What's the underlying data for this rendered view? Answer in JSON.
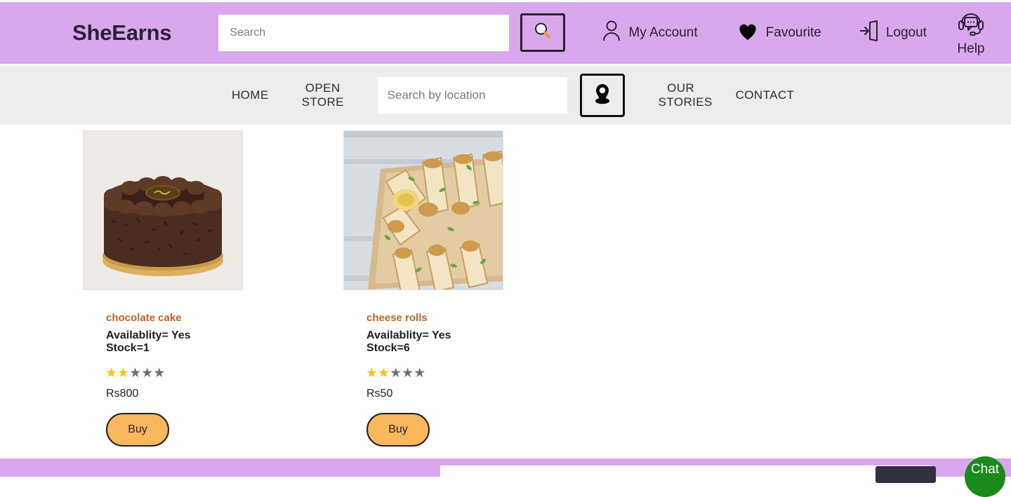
{
  "theme": {
    "header_bg": "#d9a8ec",
    "nav_bg": "#ecedef",
    "accent_orange": "#f9b75e",
    "product_title_color": "#b5652a",
    "star_on": "#f5c518",
    "star_off": "#6f6f76",
    "chat_green": "#1a8a1a",
    "dark": "#2b2036"
  },
  "header": {
    "brand": "SheEarns",
    "search": {
      "placeholder": "Search",
      "value": ""
    },
    "search_button_icon": "magnifier-icon",
    "actions": [
      {
        "label": "My Account",
        "icon": "user-icon"
      },
      {
        "label": "Favourite",
        "icon": "heart-icon"
      },
      {
        "label": "Logout",
        "icon": "logout-icon"
      },
      {
        "label": "Help",
        "icon": "headset-icon"
      }
    ]
  },
  "nav": {
    "home": "HOME",
    "open_store_line1": "OPEN",
    "open_store_line2": "STORE",
    "location_search": {
      "placeholder": "Search by location",
      "value": ""
    },
    "location_button_icon": "map-pin-icon",
    "our_stories_line1": "OUR",
    "our_stories_line2": "STORIES",
    "contact": "CONTACT"
  },
  "products": [
    {
      "name": "chocolate cake",
      "availability_line": "Availablity= Yes",
      "stock_line": "Stock=1",
      "rating": 2,
      "rating_max": 5,
      "price": "Rs800",
      "buy_label": "Buy",
      "image_alt": "chocolate-cake-photo"
    },
    {
      "name": "cheese rolls",
      "availability_line": "Availablity= Yes",
      "stock_line": "Stock=6",
      "rating": 2,
      "rating_max": 5,
      "price": "Rs50",
      "buy_label": "Buy",
      "image_alt": "cheese-rolls-photo"
    }
  ],
  "footer": {
    "input": {
      "placeholder": "",
      "value": ""
    },
    "button_label": "",
    "chat_label": "Chat"
  }
}
